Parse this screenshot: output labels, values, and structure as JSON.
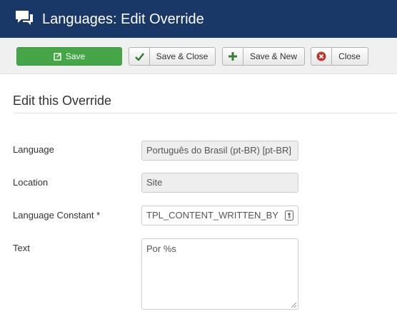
{
  "header": {
    "title": "Languages: Edit Override",
    "icon": "comments-icon"
  },
  "toolbar": {
    "save_label": "Save",
    "save_close_label": "Save & Close",
    "save_new_label": "Save & New",
    "close_label": "Close"
  },
  "form": {
    "legend": "Edit this Override",
    "language_label": "Language",
    "language_value": "Português do Brasil (pt-BR) [pt-BR]",
    "location_label": "Location",
    "location_value": "Site",
    "constant_label": "Language Constant *",
    "constant_value": "TPL_CONTENT_WRITTEN_BY",
    "text_label": "Text",
    "text_value": "Por %s"
  },
  "colors": {
    "header_bg": "#1a3867",
    "save_green": "#46a546",
    "toolbar_bg": "#f0f0f0",
    "close_icon_red": "#bd362f",
    "plus_icon_green": "#378137"
  }
}
